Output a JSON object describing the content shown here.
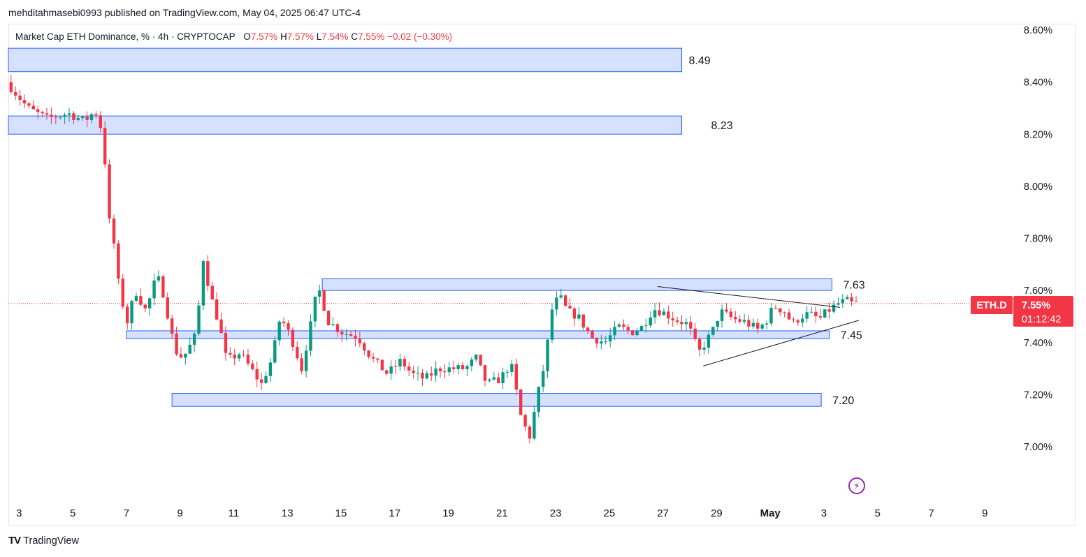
{
  "publisher": "mehditahmasebi0993 published on TradingView.com, May 04, 2025 06:47 UTC-4",
  "footer": {
    "brand": "TradingView",
    "mark": "TV"
  },
  "legend": {
    "title": "Market Cap ETH Dominance, % · 4h · CRYPTOCAP",
    "o_label": "O",
    "o_value": "7.57%",
    "h_label": "H",
    "h_value": "7.57%",
    "l_label": "L",
    "l_value": "7.54%",
    "c_label": "C",
    "c_value": "7.55%",
    "change": "−0.02 (−0.30%)"
  },
  "price_badge": {
    "symbol": "ETH.D",
    "price": "7.55%",
    "countdown": "01:12:42"
  },
  "colors": {
    "up": "#089981",
    "down": "#f23645",
    "zone_fill": "#d6e0ff",
    "zone_stroke": "#2962ff",
    "line": "#131722"
  },
  "icons": {
    "bolt": "lightning-icon"
  },
  "chart_data": {
    "type": "candlestick",
    "symbol": "ETH.D",
    "interval": "4h",
    "ylim": [
      6.88,
      8.64
    ],
    "y_ticks": [
      "8.60%",
      "8.40%",
      "8.20%",
      "8.00%",
      "7.80%",
      "7.60%",
      "7.40%",
      "7.20%",
      "7.00%"
    ],
    "y_tick_values": [
      8.6,
      8.4,
      8.2,
      8.0,
      7.8,
      7.6,
      7.4,
      7.2,
      7.0
    ],
    "x_ticks": [
      "3",
      "5",
      "7",
      "9",
      "11",
      "13",
      "15",
      "17",
      "19",
      "21",
      "23",
      "25",
      "27",
      "29",
      "May",
      "3",
      "5",
      "7",
      "9"
    ],
    "x_tick_days": [
      3,
      5,
      7,
      9,
      11,
      13,
      15,
      17,
      19,
      21,
      23,
      25,
      27,
      29,
      31,
      33,
      35,
      37,
      39
    ],
    "x_range_days": [
      2.6,
      39.8
    ],
    "current_price": 7.55,
    "zones": [
      {
        "label": "8.49",
        "top": 8.53,
        "bottom": 8.44,
        "x_start": 2.6,
        "x_end": 27.7
      },
      {
        "label": "8.23",
        "top": 8.27,
        "bottom": 8.2,
        "x_start": 2.6,
        "x_end": 27.7
      },
      {
        "label": "7.63",
        "top": 7.645,
        "bottom": 7.6,
        "x_start": 14.3,
        "x_end": 33.3
      },
      {
        "label": "7.45",
        "top": 7.445,
        "bottom": 7.415,
        "x_start": 7.0,
        "x_end": 33.2
      },
      {
        "label": "7.20",
        "top": 7.205,
        "bottom": 7.155,
        "x_start": 8.7,
        "x_end": 32.9
      }
    ],
    "triangle": {
      "upper": {
        "from": [
          26.8,
          7.615
        ],
        "to": [
          33.6,
          7.535
        ]
      },
      "lower": {
        "from": [
          28.5,
          7.31
        ],
        "to": [
          34.3,
          7.485
        ]
      }
    },
    "waypoints": [
      [
        2.7,
        8.4
      ],
      [
        3.5,
        8.3
      ],
      [
        4.2,
        8.26
      ],
      [
        5.0,
        8.28
      ],
      [
        5.6,
        8.25
      ],
      [
        6.0,
        8.29
      ],
      [
        6.3,
        8.2
      ],
      [
        6.5,
        7.88
      ],
      [
        6.7,
        7.78
      ],
      [
        6.9,
        7.6
      ],
      [
        7.2,
        7.48
      ],
      [
        7.5,
        7.6
      ],
      [
        7.9,
        7.52
      ],
      [
        8.3,
        7.66
      ],
      [
        8.6,
        7.57
      ],
      [
        8.8,
        7.45
      ],
      [
        9.1,
        7.34
      ],
      [
        9.4,
        7.36
      ],
      [
        9.8,
        7.44
      ],
      [
        10.0,
        7.74
      ],
      [
        10.3,
        7.58
      ],
      [
        10.6,
        7.48
      ],
      [
        10.9,
        7.33
      ],
      [
        11.4,
        7.36
      ],
      [
        11.8,
        7.3
      ],
      [
        12.2,
        7.24
      ],
      [
        12.6,
        7.34
      ],
      [
        12.9,
        7.5
      ],
      [
        13.3,
        7.42
      ],
      [
        13.7,
        7.3
      ],
      [
        14.1,
        7.5
      ],
      [
        14.3,
        7.62
      ],
      [
        14.7,
        7.48
      ],
      [
        15.2,
        7.44
      ],
      [
        15.8,
        7.42
      ],
      [
        16.3,
        7.34
      ],
      [
        16.9,
        7.28
      ],
      [
        17.4,
        7.33
      ],
      [
        17.8,
        7.28
      ],
      [
        18.3,
        7.26
      ],
      [
        18.8,
        7.3
      ],
      [
        19.3,
        7.3
      ],
      [
        19.8,
        7.3
      ],
      [
        20.2,
        7.34
      ],
      [
        20.6,
        7.24
      ],
      [
        21.1,
        7.26
      ],
      [
        21.5,
        7.32
      ],
      [
        21.9,
        7.1
      ],
      [
        22.2,
        7.04
      ],
      [
        22.5,
        7.2
      ],
      [
        22.8,
        7.34
      ],
      [
        23.0,
        7.52
      ],
      [
        23.3,
        7.58
      ],
      [
        23.6,
        7.52
      ],
      [
        24.0,
        7.5
      ],
      [
        24.5,
        7.42
      ],
      [
        25.0,
        7.4
      ],
      [
        25.5,
        7.46
      ],
      [
        26.0,
        7.44
      ],
      [
        26.4,
        7.46
      ],
      [
        26.8,
        7.53
      ],
      [
        27.1,
        7.52
      ],
      [
        27.6,
        7.49
      ],
      [
        28.1,
        7.47
      ],
      [
        28.5,
        7.36
      ],
      [
        29.0,
        7.44
      ],
      [
        29.3,
        7.52
      ],
      [
        29.8,
        7.49
      ],
      [
        30.2,
        7.48
      ],
      [
        30.7,
        7.45
      ],
      [
        31.0,
        7.48
      ],
      [
        31.3,
        7.54
      ],
      [
        31.7,
        7.52
      ],
      [
        32.0,
        7.47
      ],
      [
        32.3,
        7.5
      ],
      [
        32.6,
        7.51
      ],
      [
        33.0,
        7.49
      ],
      [
        33.3,
        7.52
      ],
      [
        33.7,
        7.55
      ],
      [
        34.0,
        7.56
      ],
      [
        34.2,
        7.55
      ]
    ]
  }
}
